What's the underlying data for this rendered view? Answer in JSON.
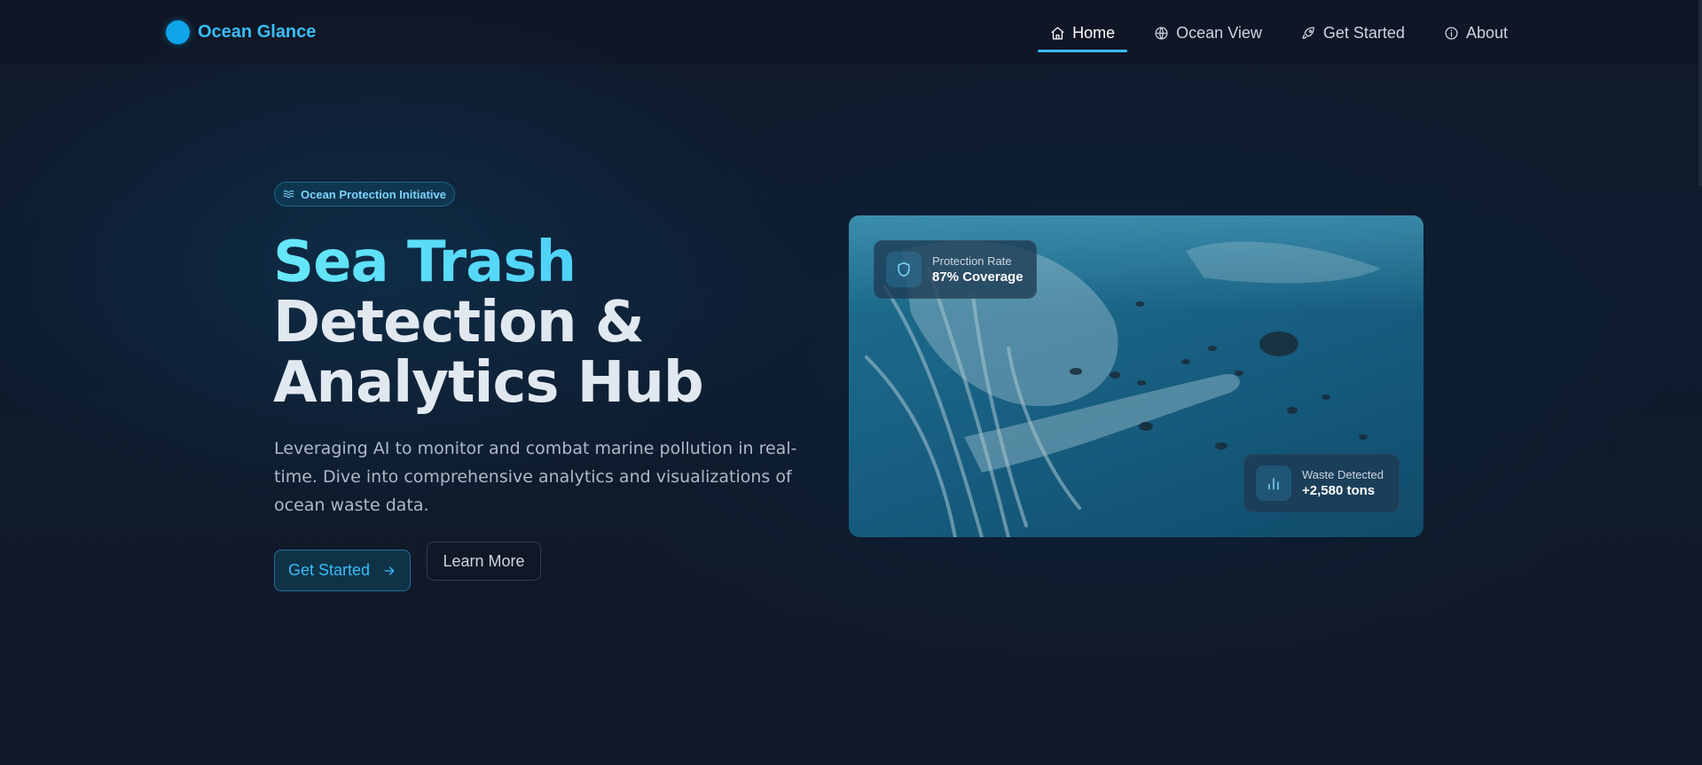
{
  "brand": {
    "name": "Ocean Glance",
    "accent": "#38bdf8"
  },
  "nav": {
    "items": [
      {
        "label": "Home",
        "icon": "home-icon",
        "active": true
      },
      {
        "label": "Ocean View",
        "icon": "globe-icon",
        "active": false
      },
      {
        "label": "Get Started",
        "icon": "rocket-icon",
        "active": false
      },
      {
        "label": "About",
        "icon": "info-icon",
        "active": false
      }
    ]
  },
  "hero": {
    "badge": "Ocean Protection Initiative",
    "title_line1": "Sea Trash",
    "title_line2": "Detection &",
    "title_line3": "Analytics Hub",
    "description": "Leveraging AI to monitor and combat marine pollution in real-time. Dive into comprehensive analytics and visualizations of ocean waste data.",
    "primary_button": "Get Started",
    "secondary_button": "Learn More"
  },
  "stats": {
    "protection": {
      "label": "Protection Rate",
      "value": "87% Coverage",
      "icon": "shield-icon"
    },
    "waste": {
      "label": "Waste Detected",
      "value": "+2,580 tons",
      "icon": "bar-chart-icon"
    }
  }
}
